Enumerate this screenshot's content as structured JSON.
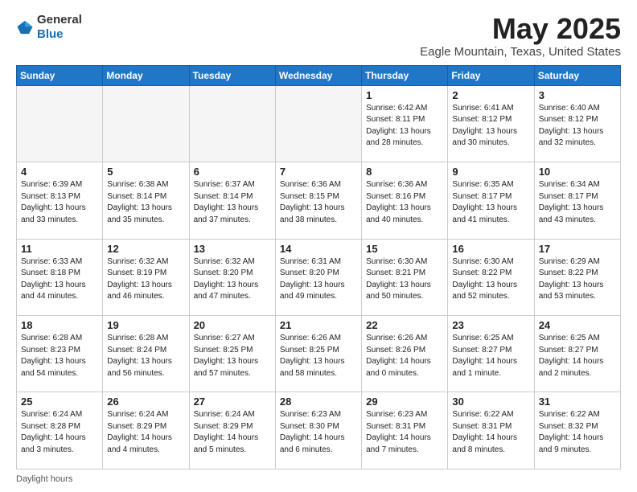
{
  "logo": {
    "general": "General",
    "blue": "Blue"
  },
  "title": "May 2025",
  "subtitle": "Eagle Mountain, Texas, United States",
  "days_header": [
    "Sunday",
    "Monday",
    "Tuesday",
    "Wednesday",
    "Thursday",
    "Friday",
    "Saturday"
  ],
  "weeks": [
    [
      {
        "day": "",
        "info": ""
      },
      {
        "day": "",
        "info": ""
      },
      {
        "day": "",
        "info": ""
      },
      {
        "day": "",
        "info": ""
      },
      {
        "day": "1",
        "info": "Sunrise: 6:42 AM\nSunset: 8:11 PM\nDaylight: 13 hours and 28 minutes."
      },
      {
        "day": "2",
        "info": "Sunrise: 6:41 AM\nSunset: 8:12 PM\nDaylight: 13 hours and 30 minutes."
      },
      {
        "day": "3",
        "info": "Sunrise: 6:40 AM\nSunset: 8:12 PM\nDaylight: 13 hours and 32 minutes."
      }
    ],
    [
      {
        "day": "4",
        "info": "Sunrise: 6:39 AM\nSunset: 8:13 PM\nDaylight: 13 hours and 33 minutes."
      },
      {
        "day": "5",
        "info": "Sunrise: 6:38 AM\nSunset: 8:14 PM\nDaylight: 13 hours and 35 minutes."
      },
      {
        "day": "6",
        "info": "Sunrise: 6:37 AM\nSunset: 8:14 PM\nDaylight: 13 hours and 37 minutes."
      },
      {
        "day": "7",
        "info": "Sunrise: 6:36 AM\nSunset: 8:15 PM\nDaylight: 13 hours and 38 minutes."
      },
      {
        "day": "8",
        "info": "Sunrise: 6:36 AM\nSunset: 8:16 PM\nDaylight: 13 hours and 40 minutes."
      },
      {
        "day": "9",
        "info": "Sunrise: 6:35 AM\nSunset: 8:17 PM\nDaylight: 13 hours and 41 minutes."
      },
      {
        "day": "10",
        "info": "Sunrise: 6:34 AM\nSunset: 8:17 PM\nDaylight: 13 hours and 43 minutes."
      }
    ],
    [
      {
        "day": "11",
        "info": "Sunrise: 6:33 AM\nSunset: 8:18 PM\nDaylight: 13 hours and 44 minutes."
      },
      {
        "day": "12",
        "info": "Sunrise: 6:32 AM\nSunset: 8:19 PM\nDaylight: 13 hours and 46 minutes."
      },
      {
        "day": "13",
        "info": "Sunrise: 6:32 AM\nSunset: 8:20 PM\nDaylight: 13 hours and 47 minutes."
      },
      {
        "day": "14",
        "info": "Sunrise: 6:31 AM\nSunset: 8:20 PM\nDaylight: 13 hours and 49 minutes."
      },
      {
        "day": "15",
        "info": "Sunrise: 6:30 AM\nSunset: 8:21 PM\nDaylight: 13 hours and 50 minutes."
      },
      {
        "day": "16",
        "info": "Sunrise: 6:30 AM\nSunset: 8:22 PM\nDaylight: 13 hours and 52 minutes."
      },
      {
        "day": "17",
        "info": "Sunrise: 6:29 AM\nSunset: 8:22 PM\nDaylight: 13 hours and 53 minutes."
      }
    ],
    [
      {
        "day": "18",
        "info": "Sunrise: 6:28 AM\nSunset: 8:23 PM\nDaylight: 13 hours and 54 minutes."
      },
      {
        "day": "19",
        "info": "Sunrise: 6:28 AM\nSunset: 8:24 PM\nDaylight: 13 hours and 56 minutes."
      },
      {
        "day": "20",
        "info": "Sunrise: 6:27 AM\nSunset: 8:25 PM\nDaylight: 13 hours and 57 minutes."
      },
      {
        "day": "21",
        "info": "Sunrise: 6:26 AM\nSunset: 8:25 PM\nDaylight: 13 hours and 58 minutes."
      },
      {
        "day": "22",
        "info": "Sunrise: 6:26 AM\nSunset: 8:26 PM\nDaylight: 14 hours and 0 minutes."
      },
      {
        "day": "23",
        "info": "Sunrise: 6:25 AM\nSunset: 8:27 PM\nDaylight: 14 hours and 1 minute."
      },
      {
        "day": "24",
        "info": "Sunrise: 6:25 AM\nSunset: 8:27 PM\nDaylight: 14 hours and 2 minutes."
      }
    ],
    [
      {
        "day": "25",
        "info": "Sunrise: 6:24 AM\nSunset: 8:28 PM\nDaylight: 14 hours and 3 minutes."
      },
      {
        "day": "26",
        "info": "Sunrise: 6:24 AM\nSunset: 8:29 PM\nDaylight: 14 hours and 4 minutes."
      },
      {
        "day": "27",
        "info": "Sunrise: 6:24 AM\nSunset: 8:29 PM\nDaylight: 14 hours and 5 minutes."
      },
      {
        "day": "28",
        "info": "Sunrise: 6:23 AM\nSunset: 8:30 PM\nDaylight: 14 hours and 6 minutes."
      },
      {
        "day": "29",
        "info": "Sunrise: 6:23 AM\nSunset: 8:31 PM\nDaylight: 14 hours and 7 minutes."
      },
      {
        "day": "30",
        "info": "Sunrise: 6:22 AM\nSunset: 8:31 PM\nDaylight: 14 hours and 8 minutes."
      },
      {
        "day": "31",
        "info": "Sunrise: 6:22 AM\nSunset: 8:32 PM\nDaylight: 14 hours and 9 minutes."
      }
    ]
  ],
  "footer": "Daylight hours"
}
